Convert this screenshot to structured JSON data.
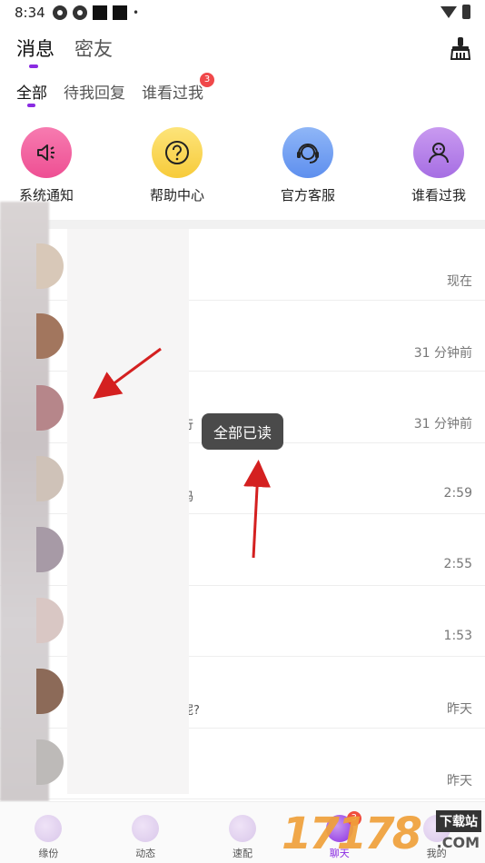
{
  "status_bar": {
    "time": "8:34"
  },
  "top_tabs": [
    {
      "label": "消息"
    },
    {
      "label": "密友"
    }
  ],
  "sub_tabs": [
    {
      "label": "全部"
    },
    {
      "label": "待我回复"
    },
    {
      "label": "谁看过我",
      "badge": "3"
    }
  ],
  "quick_entries": [
    {
      "label": "系统通知",
      "icon": "speaker-icon",
      "color": "#f25b9e"
    },
    {
      "label": "帮助中心",
      "icon": "question-icon",
      "color": "#f8d24a"
    },
    {
      "label": "官方客服",
      "icon": "headset-icon",
      "color": "#6f9ef3"
    },
    {
      "label": "谁看过我",
      "icon": "user-icon",
      "color": "#b27be8"
    }
  ],
  "chats": [
    {
      "time": "现在",
      "preview": ""
    },
    {
      "time": "31 分钟前",
      "preview": ""
    },
    {
      "time": "31 分钟前",
      "preview": "行"
    },
    {
      "time": "2:59",
      "preview": "吗"
    },
    {
      "time": "2:55",
      "preview": ""
    },
    {
      "time": "1:53",
      "preview": ""
    },
    {
      "time": "昨天",
      "preview": "呢?"
    },
    {
      "time": "昨天",
      "preview": ""
    }
  ],
  "toast": {
    "text": "全部已读"
  },
  "bottom_nav": [
    {
      "label": "缘份"
    },
    {
      "label": "动态"
    },
    {
      "label": "速配"
    },
    {
      "label": "聊天",
      "badge": "3"
    },
    {
      "label": "我的"
    }
  ],
  "watermark": {
    "number": "17178",
    "tag": "下载站",
    "domain": ".COM"
  },
  "colors": {
    "accent": "#8a2be2",
    "badge": "#f0484a",
    "arrow": "#d42020"
  }
}
